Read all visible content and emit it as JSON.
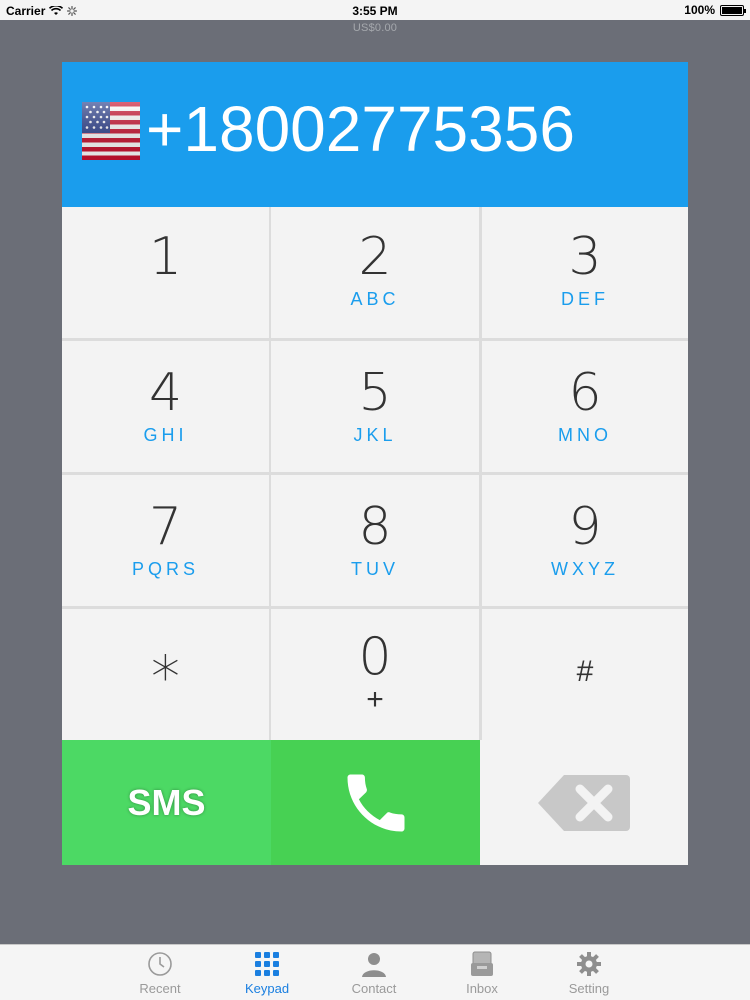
{
  "status_bar": {
    "carrier": "Carrier",
    "time": "3:55 PM",
    "battery": "100%",
    "battery_level": 1.0
  },
  "balance": "US$0.00",
  "dialer": {
    "number": "+18002775356",
    "country_flag": "us-flag-icon",
    "keys": [
      {
        "digit": "1",
        "letters": ""
      },
      {
        "digit": "2",
        "letters": "ABC"
      },
      {
        "digit": "3",
        "letters": "DEF"
      },
      {
        "digit": "4",
        "letters": "GHI"
      },
      {
        "digit": "5",
        "letters": "JKL"
      },
      {
        "digit": "6",
        "letters": "MNO"
      },
      {
        "digit": "7",
        "letters": "PQRS"
      },
      {
        "digit": "8",
        "letters": "TUV"
      },
      {
        "digit": "9",
        "letters": "WXYZ"
      },
      {
        "digit": "*",
        "letters": ""
      },
      {
        "digit": "0",
        "letters": "+"
      },
      {
        "digit": "#",
        "letters": ""
      }
    ],
    "sms_label": "SMS",
    "call_icon": "phone-icon",
    "delete_icon": "backspace-icon"
  },
  "tabs": [
    {
      "label": "Recent",
      "icon": "clock-icon",
      "active": false
    },
    {
      "label": "Keypad",
      "icon": "keypad-icon",
      "active": true
    },
    {
      "label": "Contact",
      "icon": "person-icon",
      "active": false
    },
    {
      "label": "Inbox",
      "icon": "inbox-icon",
      "active": false
    },
    {
      "label": "Setting",
      "icon": "gear-icon",
      "active": false
    }
  ],
  "colors": {
    "accent": "#1a9ded",
    "green": "#4cd964",
    "background": "#6b6e77"
  }
}
